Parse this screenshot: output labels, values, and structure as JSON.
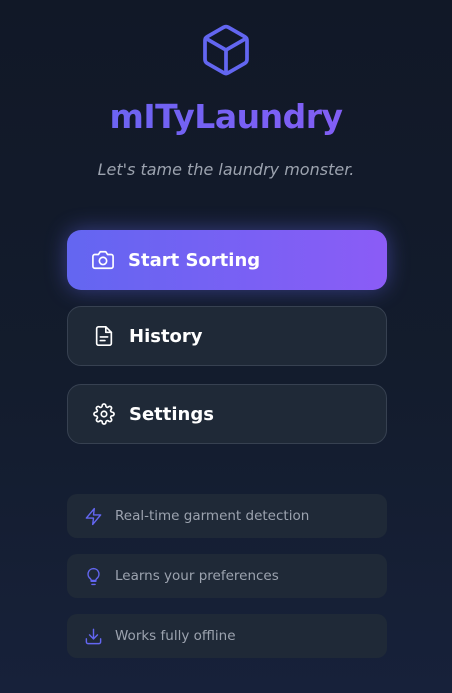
{
  "app": {
    "title": "mITyLaundry",
    "tagline": "Let's tame the laundry monster.",
    "logo_icon": "cube-icon"
  },
  "actions": [
    {
      "label": "Start Sorting",
      "icon": "camera-icon",
      "style": "primary"
    },
    {
      "label": "History",
      "icon": "document-icon",
      "style": "secondary"
    },
    {
      "label": "Settings",
      "icon": "gear-icon",
      "style": "secondary"
    }
  ],
  "features": [
    {
      "label": "Real-time garment detection",
      "icon": "lightning-icon"
    },
    {
      "label": "Learns your preferences",
      "icon": "lightbulb-icon"
    },
    {
      "label": "Works fully offline",
      "icon": "download-icon"
    }
  ],
  "colors": {
    "background": "#111827",
    "accent_start": "#6366f1",
    "accent_end": "#8b5cf6",
    "card": "#1f2937",
    "card_border": "#374151",
    "muted_text": "#9ca3af",
    "icon_accent": "#6366f1"
  }
}
